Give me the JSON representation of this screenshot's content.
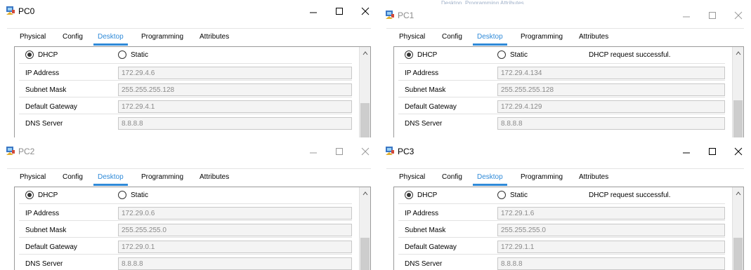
{
  "colors": {
    "accent": "#2f8ad8",
    "field_bg": "#f4f4f4",
    "field_text": "#8a8a8a"
  },
  "windows": [
    {
      "title": "PC0",
      "icon": "pc-icon",
      "tabs": [
        "Physical",
        "Config",
        "Desktop",
        "Programming",
        "Attributes"
      ],
      "active_tab": "Desktop",
      "dhcp_label": "DHCP",
      "static_label": "Static",
      "selected_mode": "DHCP",
      "status": "",
      "fields": [
        {
          "label": "IP Address",
          "value": "172.29.4.6"
        },
        {
          "label": "Subnet Mask",
          "value": "255.255.255.128"
        },
        {
          "label": "Default Gateway",
          "value": "172.29.4.1"
        },
        {
          "label": "DNS Server",
          "value": "8.8.8.8"
        }
      ]
    },
    {
      "title": "PC1",
      "icon": "pc-icon",
      "tabs": [
        "Physical",
        "Config",
        "Desktop",
        "Programming",
        "Attributes"
      ],
      "active_tab": "Desktop",
      "dhcp_label": "DHCP",
      "static_label": "Static",
      "selected_mode": "DHCP",
      "status": "DHCP request successful.",
      "fields": [
        {
          "label": "IP Address",
          "value": "172.29.4.134"
        },
        {
          "label": "Subnet Mask",
          "value": "255.255.255.128"
        },
        {
          "label": "Default Gateway",
          "value": "172.29.4.129"
        },
        {
          "label": "DNS Server",
          "value": "8.8.8.8"
        }
      ]
    },
    {
      "title": "PC2",
      "icon": "pc-icon",
      "tabs": [
        "Physical",
        "Config",
        "Desktop",
        "Programming",
        "Attributes"
      ],
      "active_tab": "Desktop",
      "dhcp_label": "DHCP",
      "static_label": "Static",
      "selected_mode": "DHCP",
      "status": "",
      "fields": [
        {
          "label": "IP Address",
          "value": "172.29.0.6"
        },
        {
          "label": "Subnet Mask",
          "value": "255.255.255.0"
        },
        {
          "label": "Default Gateway",
          "value": "172.29.0.1"
        },
        {
          "label": "DNS Server",
          "value": "8.8.8.8"
        }
      ]
    },
    {
      "title": "PC3",
      "icon": "pc-icon",
      "tabs": [
        "Physical",
        "Config",
        "Desktop",
        "Programming",
        "Attributes"
      ],
      "active_tab": "Desktop",
      "dhcp_label": "DHCP",
      "static_label": "Static",
      "selected_mode": "DHCP",
      "status": "DHCP request successful.",
      "fields": [
        {
          "label": "IP Address",
          "value": "172.29.1.6"
        },
        {
          "label": "Subnet Mask",
          "value": "255.255.255.0"
        },
        {
          "label": "Default Gateway",
          "value": "172.29.1.1"
        },
        {
          "label": "DNS Server",
          "value": "8.8.8.8"
        }
      ]
    }
  ],
  "background_tabs": [
    "Desktop",
    "Programming",
    "Attributes"
  ]
}
